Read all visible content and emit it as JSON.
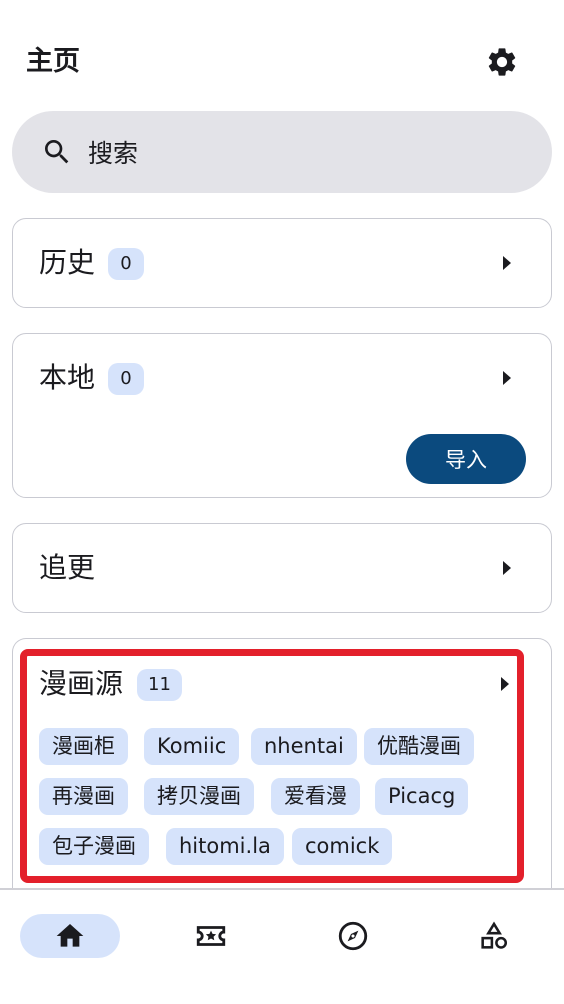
{
  "header": {
    "title": "主页",
    "settings_icon": "gear-icon"
  },
  "search": {
    "icon": "search-icon",
    "label": "搜索"
  },
  "history": {
    "title": "历史",
    "count": "0",
    "arrow_icon": "arrow-right-icon"
  },
  "local": {
    "title": "本地",
    "count": "0",
    "arrow_icon": "arrow-right-icon",
    "import_label": "导入"
  },
  "follow": {
    "title": "追更",
    "arrow_icon": "arrow-right-icon"
  },
  "sources": {
    "title": "漫画源",
    "count": "11",
    "arrow_icon": "arrow-right-icon",
    "tags": [
      "漫画柜",
      "Komiic",
      "nhentai",
      "优酷漫画",
      "再漫画",
      "拷贝漫画",
      "爱看漫",
      "Picacg",
      "包子漫画",
      "hitomi.la",
      "comick"
    ]
  },
  "bottom_nav": {
    "items": [
      {
        "icon": "home-icon",
        "active": true
      },
      {
        "icon": "favorites-icon",
        "active": false
      },
      {
        "icon": "explore-icon",
        "active": false
      },
      {
        "icon": "categories-icon",
        "active": false
      }
    ]
  },
  "colors": {
    "accent_dark": "#0b4a7e",
    "badge_bg": "#d6e3fb",
    "search_bg": "#e3e3e8",
    "highlight": "#e3202b"
  }
}
